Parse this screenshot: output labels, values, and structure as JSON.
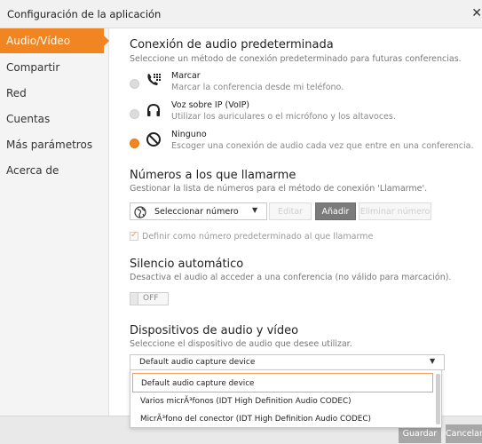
{
  "window": {
    "title": "Configuración de la aplicación",
    "close_glyph": "✕"
  },
  "sidebar": {
    "items": [
      {
        "label": "Audio/Vídeo",
        "active": true
      },
      {
        "label": "Compartir"
      },
      {
        "label": "Red"
      },
      {
        "label": "Cuentas"
      },
      {
        "label": "Más parámetros"
      },
      {
        "label": "Acerca de"
      }
    ]
  },
  "audio_connection": {
    "heading": "Conexión de audio predeterminada",
    "subtitle": "Seleccione un método de conexión predeterminado para futuras conferencias.",
    "options": [
      {
        "title": "Marcar",
        "desc": "Marcar la conferencia desde mi teléfono.",
        "icon": "phone-keypad-icon",
        "selected": false
      },
      {
        "title": "Voz sobre IP (VoIP)",
        "desc": "Utilizar los auriculares o el micrófono y los altavoces.",
        "icon": "headset-icon",
        "selected": false
      },
      {
        "title": "Ninguno",
        "desc": "Escoger una conexión de audio cada vez que entre en una conferencia.",
        "icon": "no-symbol-icon",
        "selected": true
      }
    ]
  },
  "call_numbers": {
    "heading": "Números a los que llamarme",
    "subtitle": "Gestionar la lista de números para el método de conexión 'Llamarme'.",
    "select_label": "Seleccionar número",
    "edit_label": "Editar",
    "add_label": "Añadir",
    "delete_label": "Eliminar número",
    "default_checkbox_label": "Definir como número predeterminado al que llamarme"
  },
  "auto_mute": {
    "heading": "Silencio automático",
    "subtitle": "Desactiva el audio al acceder a una conferencia (no válido para marcación).",
    "toggle_label": "OFF"
  },
  "devices": {
    "heading": "Dispositivos de audio y vídeo",
    "subtitle": "Seleccione el dispositivo de audio que desee utilizar.",
    "selected": "Default audio capture device",
    "options": [
      "Default audio capture device",
      "Varios micrÃ³fonos (IDT High Definition Audio CODEC)",
      "MicrÃ³fono del conector (IDT High Definition Audio CODEC)"
    ]
  },
  "footer": {
    "save_label": "Guardar",
    "cancel_label": "Cancelar"
  },
  "colors": {
    "accent": "#f08521"
  }
}
